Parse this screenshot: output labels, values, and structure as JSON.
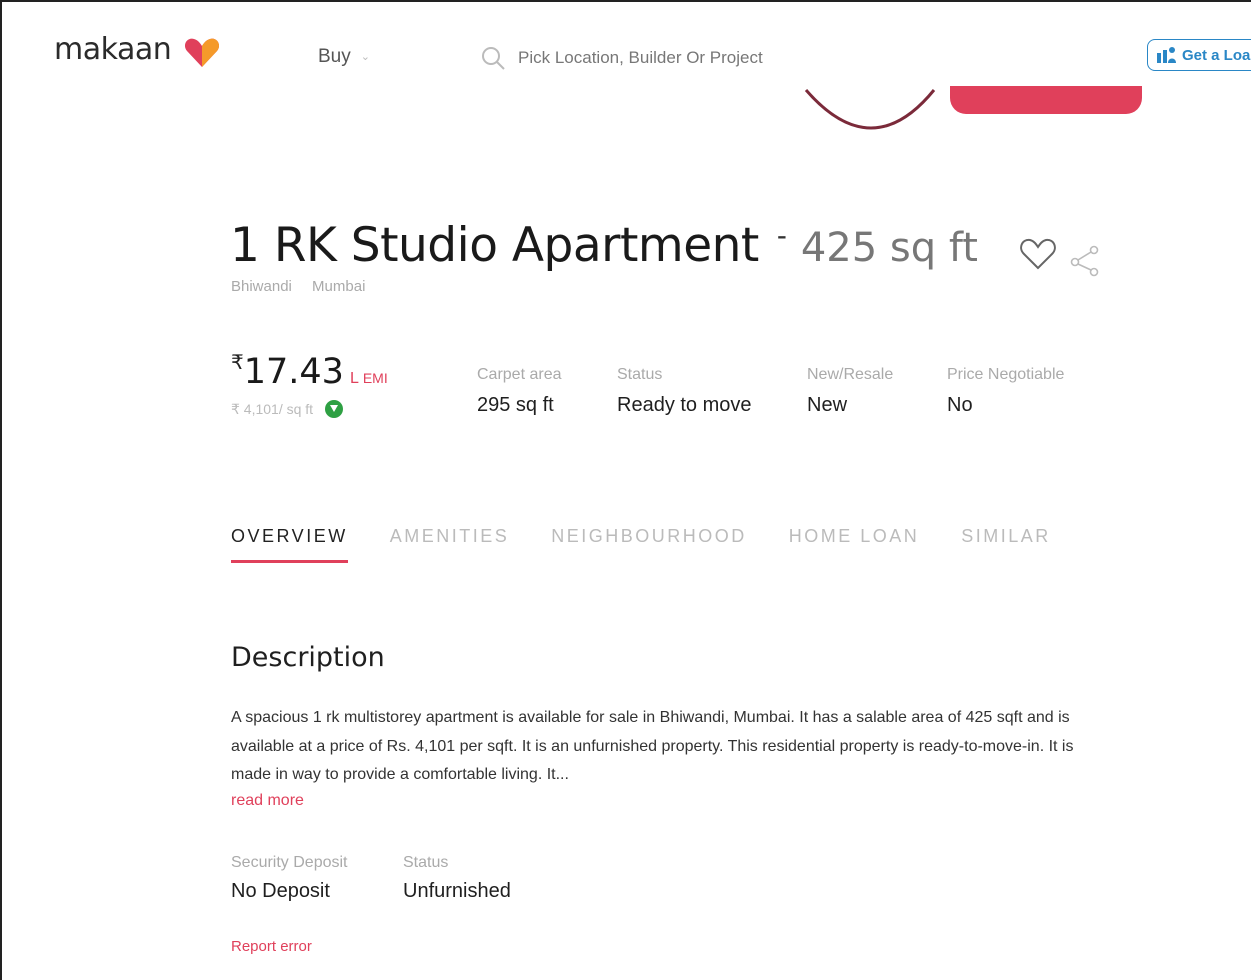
{
  "header": {
    "logo": "makaan",
    "nav_buy": "Buy",
    "search_placeholder": "Pick Location, Builder Or Project",
    "loan_button": "Get a Loan",
    "colors": {
      "brand_pink": "#e0405b",
      "loan_blue": "#2a87c6"
    }
  },
  "listing": {
    "title": "1 RK Studio Apartment",
    "separator": "-",
    "area": "425 sq ft",
    "city_area": "Bhiwandi",
    "city": "Mumbai",
    "price_symbol": "₹",
    "price_amount": "17.43",
    "price_unit": "L",
    "emi_label": "EMI",
    "price_per_sqft": "₹ 4,101/ sq ft",
    "stats": [
      {
        "label": "Carpet area",
        "value": "295 sq ft"
      },
      {
        "label": "Status",
        "value": "Ready to move"
      },
      {
        "label": "New/Resale",
        "value": "New"
      },
      {
        "label": "Price Negotiable",
        "value": "No"
      }
    ]
  },
  "tabs": [
    "OVERVIEW",
    "AMENITIES",
    "NEIGHBOURHOOD",
    "HOME LOAN",
    "SIMILAR"
  ],
  "overview": {
    "heading": "Description",
    "description": "A spacious 1 rk multistorey apartment is available for sale in Bhiwandi, Mumbai. It has a salable area of 425 sqft and is available at a price of Rs. 4,101 per sqft. It is an unfurnished property. This residential property is ready-to-move-in. It is made in way to provide a comfortable living. It...",
    "read_more": "read more",
    "details": [
      {
        "label": "Security Deposit",
        "value": "No Deposit"
      },
      {
        "label": "Status",
        "value": "Unfurnished"
      }
    ],
    "report_error": "Report error"
  }
}
